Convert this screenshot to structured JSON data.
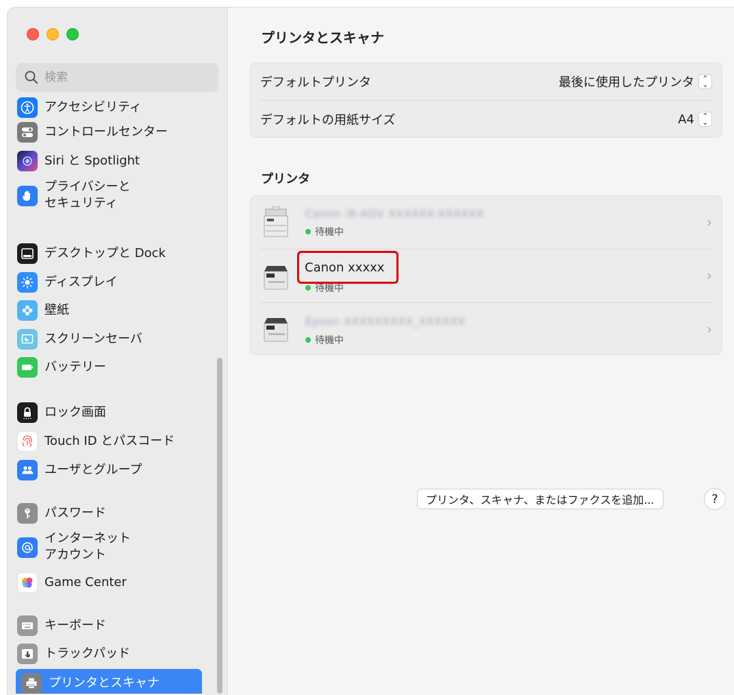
{
  "window": {
    "title": "プリンタとスキャナ"
  },
  "search": {
    "placeholder": "検索"
  },
  "sidebar": {
    "items": [
      {
        "label": "アクセシビリティ",
        "icon": "accessibility-icon",
        "color": "#1a7cf5"
      },
      {
        "label": "コントロールセンター",
        "icon": "control-center-icon",
        "color": "#7a7a7a"
      },
      {
        "label": "Siri と Spotlight",
        "icon": "siri-icon",
        "color": "#5a4bd1"
      },
      {
        "label": "プライバシーと\nセキュリティ",
        "icon": "hand-icon",
        "color": "#2f7ef6"
      },
      {
        "label": "デスクトップと Dock",
        "icon": "dock-icon",
        "color": "#1d1d1f"
      },
      {
        "label": "ディスプレイ",
        "icon": "display-icon",
        "color": "#2f8ef8"
      },
      {
        "label": "壁紙",
        "icon": "wallpaper-icon",
        "color": "#4fb4f0"
      },
      {
        "label": "スクリーンセーバ",
        "icon": "screensaver-icon",
        "color": "#6cc4e6"
      },
      {
        "label": "バッテリー",
        "icon": "battery-icon",
        "color": "#35c759"
      },
      {
        "label": "ロック画面",
        "icon": "lock-icon",
        "color": "#1d1d1f"
      },
      {
        "label": "Touch ID とパスコード",
        "icon": "fingerprint-icon",
        "color": "#f15b5b"
      },
      {
        "label": "ユーザとグループ",
        "icon": "users-icon",
        "color": "#2f7ef6"
      },
      {
        "label": "パスワード",
        "icon": "key-icon",
        "color": "#8e8e8e"
      },
      {
        "label": "インターネット\nアカウント",
        "icon": "at-icon",
        "color": "#2f7ef6"
      },
      {
        "label": "Game Center",
        "icon": "game-center-icon",
        "color": "#f0a43b"
      },
      {
        "label": "キーボード",
        "icon": "keyboard-icon",
        "color": "#9a9a9a"
      },
      {
        "label": "トラックパッド",
        "icon": "trackpad-icon",
        "color": "#9a9a9a"
      },
      {
        "label": "プリンタとスキャナ",
        "icon": "printer-icon",
        "color": "#7f7f7f"
      }
    ],
    "active_index": 17
  },
  "defaults": {
    "default_printer_label": "デフォルトプリンタ",
    "default_printer_value": "最後に使用したプリンタ",
    "paper_size_label": "デフォルトの用紙サイズ",
    "paper_size_value": "A4"
  },
  "printers_section": {
    "title": "プリンタ",
    "items": [
      {
        "name": "Canon iR-ADV XXXXXX-XXXXXX",
        "status": "待機中"
      },
      {
        "name": "Canon xxxxx",
        "status": "待機中"
      },
      {
        "name": "Epson XXXXXXXXX_XXXXXX",
        "status": "待機中"
      }
    ]
  },
  "actions": {
    "add_button": "プリンタ、スキャナ、またはファクスを追加...",
    "help_button": "?"
  },
  "colors": {
    "accent": "#3a86f7",
    "highlight_border": "#e00000",
    "status_green": "#34c759"
  }
}
